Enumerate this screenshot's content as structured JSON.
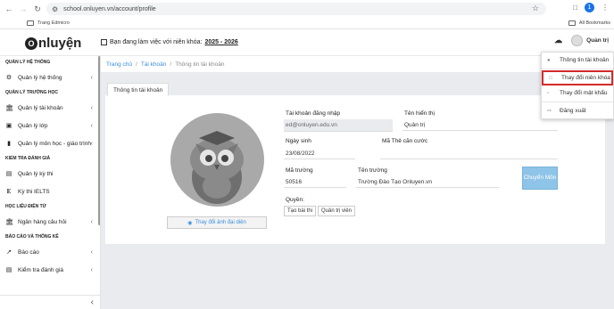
{
  "browser": {
    "url": "school.onluyen.vn/account/profile",
    "bookmark": "Trang Edmicro",
    "all_bookmarks": "All Bookmarks",
    "profile_initial": "1"
  },
  "header": {
    "logo": "nluyện",
    "logo_letter": "O",
    "year_text": "Bạn đang làm việc với niên khóa:",
    "year_value": "2025 - 2026",
    "user_name": "Quản trị"
  },
  "sidebar": {
    "sections": [
      {
        "title": "QUẢN LÝ HỆ THỐNG",
        "items": [
          {
            "label": "Quản lý hệ thống",
            "icon": "gear",
            "chevron": true
          }
        ]
      },
      {
        "title": "QUẢN LÝ TRƯỜNG HỌC",
        "items": [
          {
            "label": "Quản lý tài khoản",
            "icon": "bank",
            "chevron": true
          },
          {
            "label": "Quản lý lớp",
            "icon": "desktop",
            "chevron": true
          },
          {
            "label": "Quản lý môn học - giáo trình",
            "icon": "book",
            "chevron": true
          }
        ]
      },
      {
        "title": "KIỂM TRA ĐÁNH GIÁ",
        "items": [
          {
            "label": "Quản lý kỳ thi",
            "icon": "doc",
            "chevron": false
          },
          {
            "label": "Kỳ thi IELTS",
            "icon": "E",
            "chevron": false
          }
        ]
      },
      {
        "title": "HỌC LIỆU ĐIỆN TỬ",
        "items": [
          {
            "label": "Ngân hàng câu hỏi",
            "icon": "bank",
            "chevron": true
          }
        ]
      },
      {
        "title": "BÁO CÁO VÀ THỐNG KÊ",
        "items": [
          {
            "label": "Báo cáo",
            "icon": "chart",
            "chevron": true
          },
          {
            "label": "Kiểm tra đánh giá",
            "icon": "doc",
            "chevron": true
          }
        ]
      }
    ]
  },
  "breadcrumb": {
    "home": "Trang chủ",
    "account": "Tài khoản",
    "current": "Thông tin tài khoản"
  },
  "tab": "Thông tin tài khoản",
  "form": {
    "change_photo": "Thay đổi ảnh đại diện",
    "login_label": "Tài khoản đăng nhập",
    "login_value": "ed@onluyen.edu.vn",
    "display_label": "Tên hiển thị",
    "display_value": "Quản trị",
    "dob_label": "Ngày sinh",
    "dob_value": "23/08/2022",
    "id_label": "Mã Thẻ căn cước",
    "id_value": "",
    "school_code_label": "Mã trường",
    "school_code_value": "50516",
    "school_name_label": "Tên trường",
    "school_name_value": "Trường Đào Tạo Onluyen.vn",
    "switch_button": "Chuyển Môn",
    "roles_label": "Quyền:",
    "roles": [
      "Tạo bài thi",
      "Quản trị viên"
    ]
  },
  "dropdown": {
    "items": [
      "Thông tin tài khoản",
      "Thay đổi niên khóa",
      "Thay đổi mật khẩu",
      "Đăng xuất"
    ],
    "highlight_color": "#d42a2a"
  },
  "colors": {
    "accent": "#3a8dde",
    "button": "#8ec4e8"
  }
}
